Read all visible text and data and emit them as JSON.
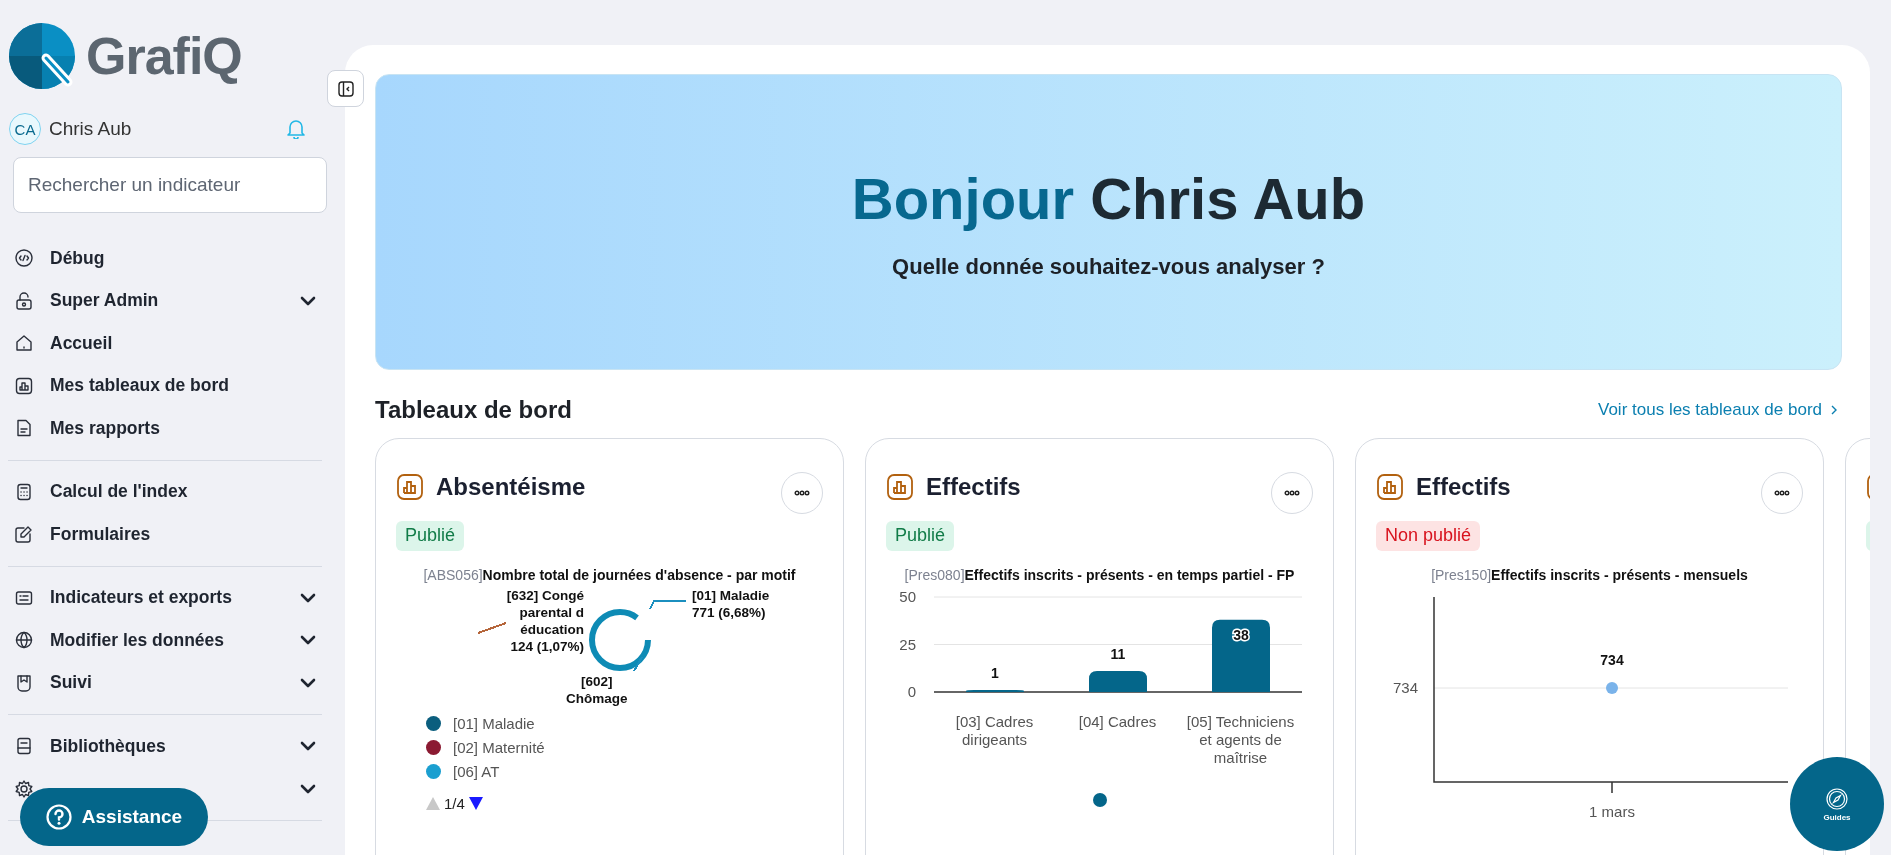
{
  "brand": {
    "name": "GrafiQ"
  },
  "user": {
    "initials": "CA",
    "name": "Chris Aub"
  },
  "search": {
    "placeholder": "Rechercher un indicateur"
  },
  "nav_groups": [
    [
      {
        "label": "Débug",
        "expandable": false
      },
      {
        "label": "Super Admin",
        "expandable": true
      },
      {
        "label": "Accueil",
        "expandable": false
      },
      {
        "label": "Mes tableaux de bord",
        "expandable": false
      },
      {
        "label": "Mes rapports",
        "expandable": false
      }
    ],
    [
      {
        "label": "Calcul de l'index",
        "expandable": false
      },
      {
        "label": "Formulaires",
        "expandable": false
      }
    ],
    [
      {
        "label": "Indicateurs et exports",
        "expandable": true
      },
      {
        "label": "Modifier les données",
        "expandable": true
      },
      {
        "label": "Suivi",
        "expandable": true
      }
    ],
    [
      {
        "label": "Bibliothèques",
        "expandable": true
      },
      {
        "expandable": true
      }
    ]
  ],
  "assistance": {
    "label": "Assistance"
  },
  "guides": {
    "label": "Guides"
  },
  "hero": {
    "greeting": "Bonjour",
    "name": "Chris Aub",
    "subtitle": "Quelle donnée souhaitez-vous analyser ?"
  },
  "section": {
    "title": "Tableaux de bord",
    "link": "Voir tous les tableaux de bord"
  },
  "cards": [
    {
      "kind": "donut",
      "title": "Absentéisme",
      "published": true,
      "status": "Publié",
      "code": "[ABS056]",
      "chart_title": "Nombre total de journées d'absence - par motif",
      "callouts": [
        {
          "text": "[632] Congé\nparental d\néducation\n124 (1,07%)",
          "color": "#b5653a"
        },
        {
          "text": "[01] Maladie\n771 (6,68%)",
          "color": "#1b8fbf"
        },
        {
          "text": "[602]\nChômage",
          "color": "#1b8fbf"
        }
      ],
      "legend": [
        {
          "label": "[01] Maladie",
          "color": "#0b5e7e"
        },
        {
          "label": "[02] Maternité",
          "color": "#8b1a32"
        },
        {
          "label": "[06] AT",
          "color": "#1b9fd0"
        }
      ],
      "pager": {
        "text": "1/4",
        "prev_disabled": true,
        "next_disabled": false
      }
    },
    {
      "kind": "bar",
      "title": "Effectifs",
      "published": true,
      "status": "Publié",
      "code": "[Pres080]",
      "chart_title": "Effectifs inscrits - présents - en temps partiel - FP",
      "chart_data": {
        "type": "bar",
        "categories": [
          "[03] Cadres dirigeants",
          "[04] Cadres",
          "[05] Techniciens et agents de maîtrise"
        ],
        "series": [
          {
            "color": "#04668a",
            "values": [
              1,
              11,
              38
            ]
          }
        ],
        "ylim": [
          0,
          50
        ],
        "yticks": [
          0,
          25,
          50
        ],
        "data_labels": true
      },
      "dots": [
        {
          "selected": true
        }
      ]
    },
    {
      "kind": "line",
      "title": "Effectifs",
      "published": false,
      "status": "Non publié",
      "code": "[Pres150]",
      "chart_title": "Effectifs inscrits - présents - mensuels",
      "y_tick": "734",
      "x_tick": "1 mars",
      "point_label": "734"
    },
    {
      "kind": "partial",
      "published": true
    }
  ]
}
